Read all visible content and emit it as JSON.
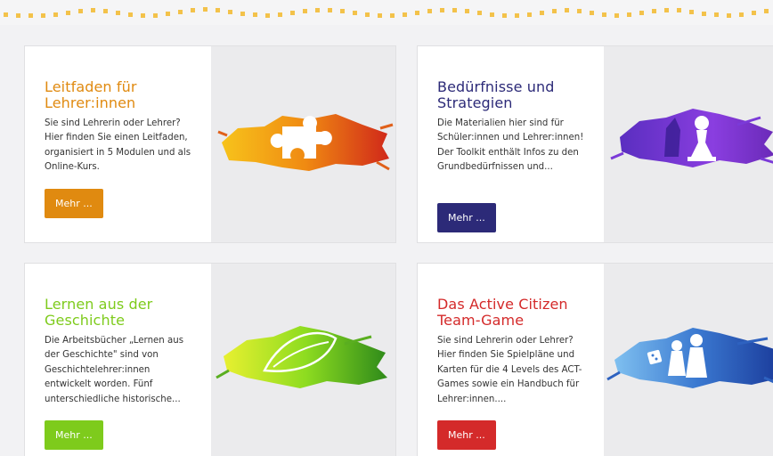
{
  "cards": [
    {
      "title": "Leitfaden für Lehrer:innen",
      "description": "Sie sind Lehrerin oder Lehrer? Hier finden Sie einen Leitfaden, organisiert in 5 Modulen und als Online-Kurs.",
      "button": "Mehr ...",
      "accent": "#e08a10",
      "icon": "puzzle-icon"
    },
    {
      "title": "Bedürfnisse und Strategien",
      "description": "Die Materialien hier sind für Schüler:innen und Lehrer:innen! Der Toolkit enthält Infos zu den Grundbedürfnissen und...",
      "button": "Mehr ...",
      "accent": "#2c2a78",
      "icon": "chess-pawn-icon"
    },
    {
      "title": "Lernen aus der Geschichte",
      "description": "Die Arbeitsbücher „Lernen aus der Geschichte\" sind von Geschichtelehrer:innen entwickelt worden. Fünf unterschiedliche historische...",
      "button": "Mehr ...",
      "accent": "#7ecb1c",
      "icon": "leaf-icon"
    },
    {
      "title": "Das Active Citizen Team-Game",
      "description": "Sie sind Lehrerin oder Lehrer? Hier finden Sie Spielpläne und Karten für die 4 Levels des ACT-Games sowie ein Handbuch für Lehrer:innen....",
      "button": "Mehr ...",
      "accent": "#d42a2a",
      "icon": "game-pieces-icon"
    }
  ],
  "colors": {
    "dots": "#f3c24a",
    "card_art_bg": "#ebebed"
  }
}
